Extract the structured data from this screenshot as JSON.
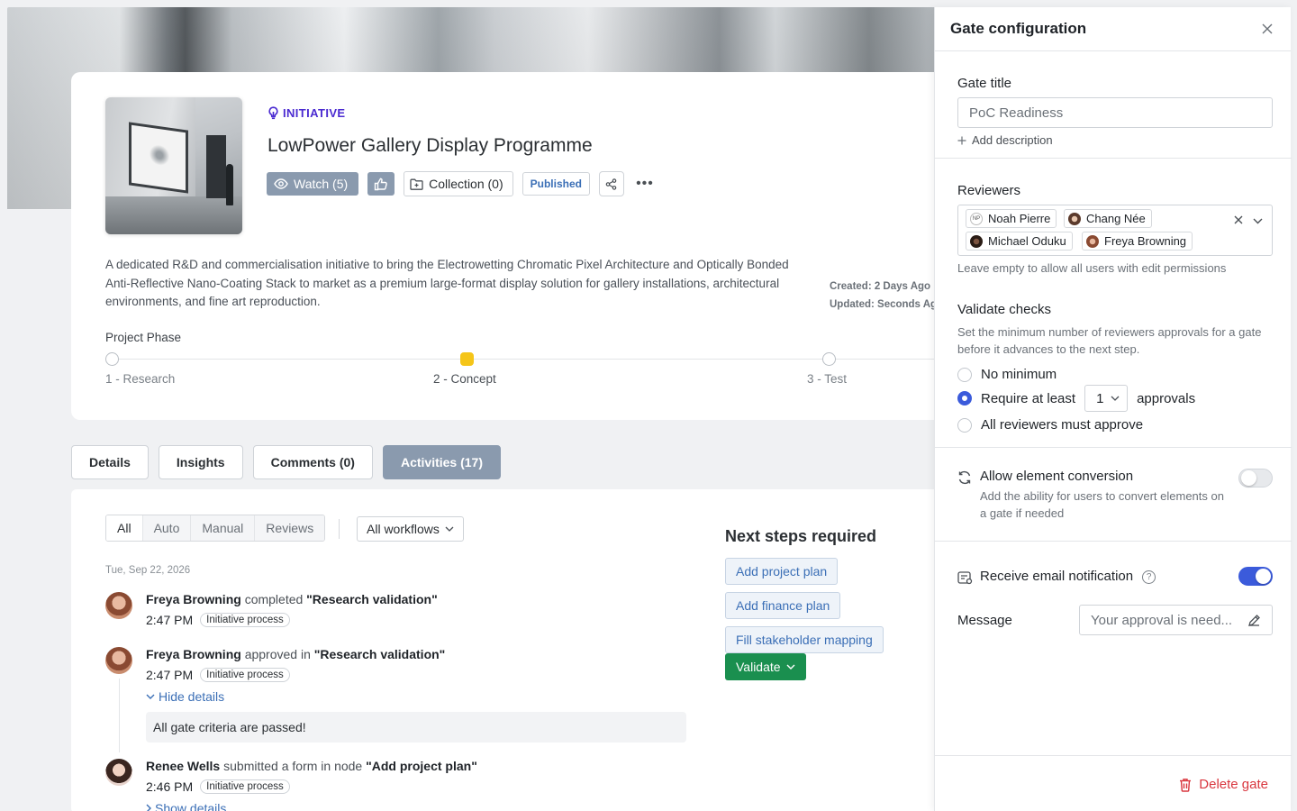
{
  "initiative": {
    "type_label": "INITIATIVE",
    "title": "LowPower Gallery Display Programme",
    "watch_label": "Watch (5)",
    "collection_label": "Collection (0)",
    "status_badge": "Published",
    "more_label": "•••",
    "description": "A dedicated R&D and commercialisation initiative to bring the Electrowetting Chromatic Pixel Architecture and Optically Bonded Anti-Reflective Nano-Coating Stack to market as a premium large-format display solution for gallery installations, architectural environments, and fine art reproduction.",
    "created": "Created: 2 Days Ago",
    "updated": "Updated: Seconds Ago",
    "colors": {
      "accent": "#4b2bd1",
      "phase_active": "#f5c518",
      "watch_bg": "#8a9aae"
    }
  },
  "phase": {
    "label": "Project Phase",
    "steps": [
      {
        "label": "1 - Research",
        "state": "inactive"
      },
      {
        "label": "2 - Concept",
        "state": "active"
      },
      {
        "label": "3 - Test",
        "state": "inactive"
      }
    ]
  },
  "tabs": [
    {
      "label": "Details",
      "active": false
    },
    {
      "label": "Insights",
      "active": false
    },
    {
      "label": "Comments (0)",
      "active": false
    },
    {
      "label": "Activities (17)",
      "active": true
    }
  ],
  "activities": {
    "filters": [
      "All",
      "Auto",
      "Manual",
      "Reviews"
    ],
    "active_filter": "All",
    "workflow_select": "All workflows",
    "date": "Tue, Sep 22, 2026",
    "items": [
      {
        "user": "Freya Browning",
        "verb": "completed",
        "prep": "",
        "target": "\"Research validation\"",
        "time": "2:47 PM",
        "tag": "Initiative process"
      },
      {
        "user": "Freya Browning",
        "verb": "approved",
        "prep": "in",
        "target": "\"Research validation\"",
        "time": "2:47 PM",
        "tag": "Initiative process",
        "toggle": "Hide details",
        "detail": "All gate criteria are passed!"
      },
      {
        "user": "Renee Wells",
        "verb": "submitted",
        "prep": "a form in node",
        "target": "\"Add project plan\"",
        "time": "2:46 PM",
        "tag": "Initiative process",
        "toggle": "Show details"
      }
    ],
    "next_steps": {
      "title": "Next steps required",
      "buttons": [
        "Add project plan",
        "Add finance plan",
        "Fill stakeholder mapping"
      ],
      "validate_label": "Validate"
    }
  },
  "drawer": {
    "title": "Gate configuration",
    "gate_title_label": "Gate title",
    "gate_title_value": "PoC Readiness",
    "add_description": "Add description",
    "reviewers_label": "Reviewers",
    "reviewers": [
      "Noah Pierre",
      "Chang Née",
      "Michael Oduku",
      "Freya Browning"
    ],
    "reviewers_avatar_initials": "NP",
    "reviewers_help": "Leave empty to allow all users with edit permissions",
    "validate_label": "Validate checks",
    "validate_help": "Set the minimum number of reviewers approvals for a gate before it advances to the next step.",
    "options": {
      "no_min": "No minimum",
      "require_prefix": "Require at least",
      "require_count": "1",
      "require_suffix": "approvals",
      "all": "All reviewers must approve",
      "selected": "require"
    },
    "conversion": {
      "title": "Allow element conversion",
      "desc": "Add the ability for users to convert elements on a gate if needed",
      "enabled": false
    },
    "email": {
      "title": "Receive email notification",
      "help_glyph": "?",
      "enabled": true
    },
    "message_label": "Message",
    "message_value": "Your approval is need...",
    "delete_label": "Delete gate",
    "colors": {
      "toggle_on": "#3b5bdb",
      "danger": "#d9363e",
      "validate_green": "#1a8f4f"
    }
  }
}
